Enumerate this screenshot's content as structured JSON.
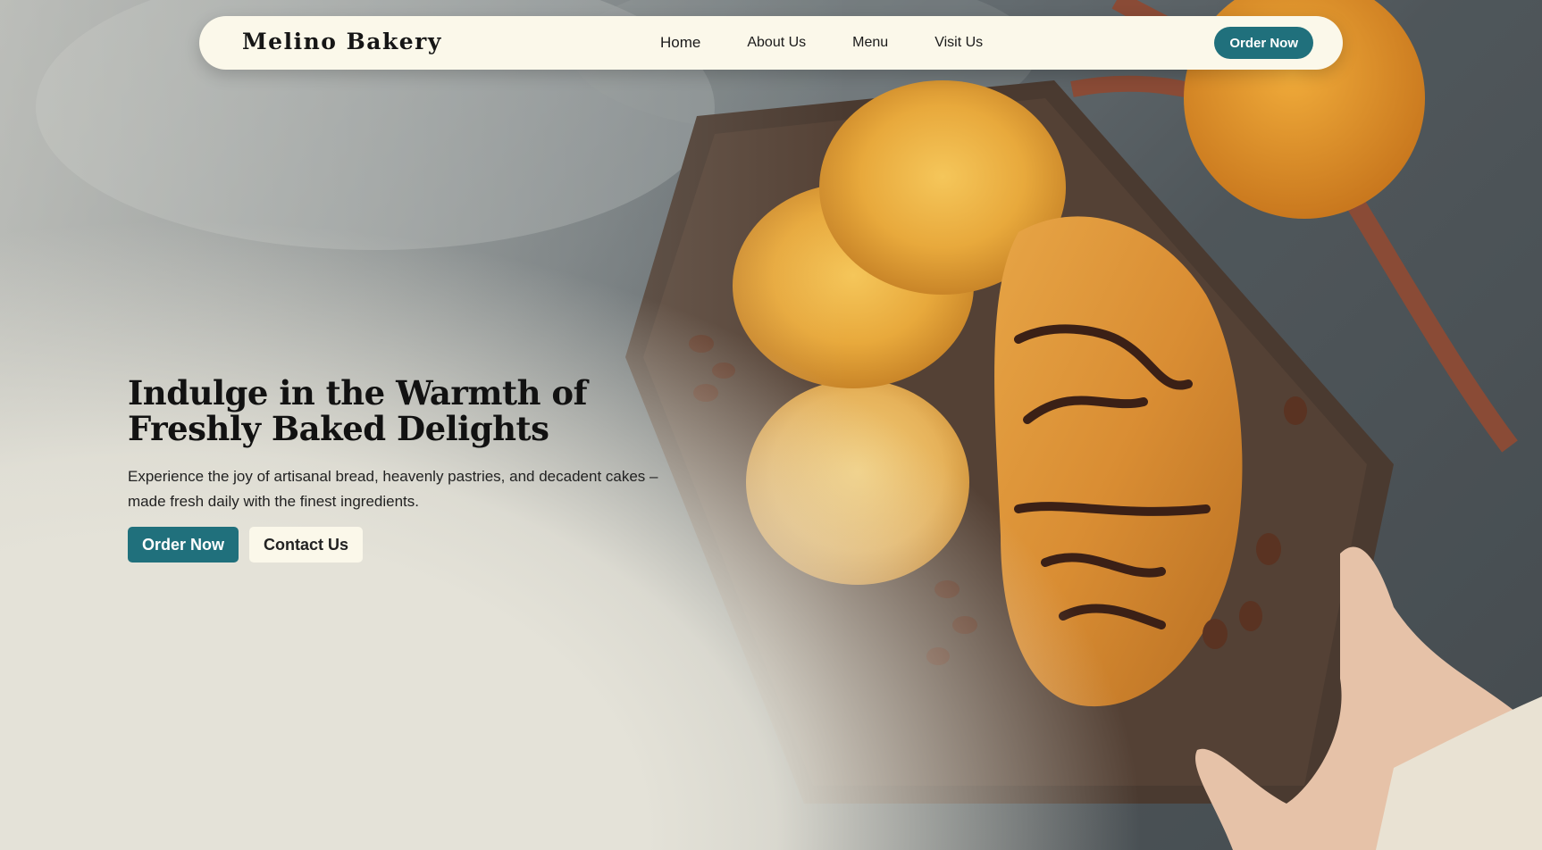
{
  "brand": {
    "name": "Melino Bakery"
  },
  "nav": {
    "links": [
      "Home",
      "About Us",
      "Menu",
      "Visit Us"
    ],
    "order_label": "Order Now"
  },
  "hero": {
    "title": "Indulge in the Warmth of Freshly Baked Delights",
    "subtitle": "Experience the joy of artisanal bread, heavenly pastries, and decadent cakes – made fresh daily with the finest ingredients.",
    "primary_label": "Order Now",
    "secondary_label": "Contact Us"
  },
  "colors": {
    "accent": "#20707c",
    "nav_bg": "#fbf8ea",
    "page_bg": "#e4e2d8",
    "text_dark": "#121212"
  },
  "icons": {
    "hero_image": "bakery-pastries-photo"
  }
}
